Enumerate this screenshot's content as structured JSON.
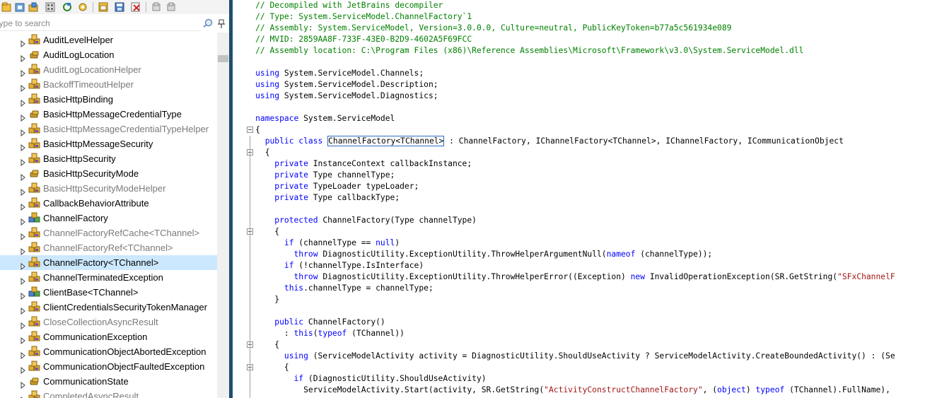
{
  "search": {
    "placeholder": "Type to search"
  },
  "tree": {
    "items": [
      {
        "label": "AuditLevelHelper",
        "dim": false,
        "icon": "class-icon",
        "selected": false
      },
      {
        "label": "AuditLogLocation",
        "dim": false,
        "icon": "enum-icon",
        "selected": false
      },
      {
        "label": "AuditLogLocationHelper",
        "dim": true,
        "icon": "class-icon",
        "selected": false
      },
      {
        "label": "BackoffTimeoutHelper",
        "dim": true,
        "icon": "class-icon",
        "selected": false
      },
      {
        "label": "BasicHttpBinding",
        "dim": false,
        "icon": "class-icon",
        "selected": false
      },
      {
        "label": "BasicHttpMessageCredentialType",
        "dim": false,
        "icon": "enum-icon",
        "selected": false
      },
      {
        "label": "BasicHttpMessageCredentialTypeHelper",
        "dim": true,
        "icon": "class-icon",
        "selected": false
      },
      {
        "label": "BasicHttpMessageSecurity",
        "dim": false,
        "icon": "class-icon",
        "selected": false
      },
      {
        "label": "BasicHttpSecurity",
        "dim": false,
        "icon": "class-icon",
        "selected": false
      },
      {
        "label": "BasicHttpSecurityMode",
        "dim": false,
        "icon": "enum-icon",
        "selected": false
      },
      {
        "label": "BasicHttpSecurityModeHelper",
        "dim": true,
        "icon": "class-icon",
        "selected": false
      },
      {
        "label": "CallbackBehaviorAttribute",
        "dim": false,
        "icon": "class-icon",
        "selected": false
      },
      {
        "label": "ChannelFactory",
        "dim": false,
        "icon": "abstract-class-icon",
        "selected": false
      },
      {
        "label": "ChannelFactoryRefCache<TChannel>",
        "dim": true,
        "icon": "class-icon",
        "selected": false
      },
      {
        "label": "ChannelFactoryRef<TChannel>",
        "dim": true,
        "icon": "class-icon",
        "selected": false
      },
      {
        "label": "ChannelFactory<TChannel>",
        "dim": false,
        "icon": "class-icon",
        "selected": true
      },
      {
        "label": "ChannelTerminatedException",
        "dim": false,
        "icon": "class-icon",
        "selected": false
      },
      {
        "label": "ClientBase<TChannel>",
        "dim": false,
        "icon": "abstract-class-icon",
        "selected": false
      },
      {
        "label": "ClientCredentialsSecurityTokenManager",
        "dim": false,
        "icon": "class-icon",
        "selected": false
      },
      {
        "label": "CloseCollectionAsyncResult",
        "dim": true,
        "icon": "class-icon",
        "selected": false
      },
      {
        "label": "CommunicationException",
        "dim": false,
        "icon": "class-icon",
        "selected": false
      },
      {
        "label": "CommunicationObjectAbortedException",
        "dim": false,
        "icon": "class-icon",
        "selected": false
      },
      {
        "label": "CommunicationObjectFaultedException",
        "dim": false,
        "icon": "class-icon",
        "selected": false
      },
      {
        "label": "CommunicationState",
        "dim": false,
        "icon": "enum-icon",
        "selected": false
      },
      {
        "label": "CompletedAsyncResult",
        "dim": true,
        "icon": "class-icon",
        "selected": false
      }
    ]
  },
  "code": {
    "lines": [
      {
        "indent": 2,
        "tokens": [
          {
            "t": "c",
            "v": "// Decompiled with JetBrains decompiler"
          }
        ]
      },
      {
        "indent": 2,
        "tokens": [
          {
            "t": "c",
            "v": "// Type: System.ServiceModel.ChannelFactory`1"
          }
        ]
      },
      {
        "indent": 2,
        "tokens": [
          {
            "t": "c",
            "v": "// Assembly: System.ServiceModel, Version=3.0.0.0, Culture=neutral, PublicKeyToken=b77a5c561934e089"
          }
        ]
      },
      {
        "indent": 2,
        "tokens": [
          {
            "t": "c",
            "v": "// MVID: 2859AA8F-733F-43E0-B2D9-4602A5F69FCC"
          }
        ]
      },
      {
        "indent": 2,
        "tokens": [
          {
            "t": "c",
            "v": "// Assembly location: C:\\Program Files (x86)\\Reference Assemblies\\Microsoft\\Framework\\v3.0\\System.ServiceModel.dll"
          }
        ]
      },
      {
        "indent": 2,
        "tokens": []
      },
      {
        "indent": 2,
        "tokens": [
          {
            "t": "k",
            "v": "using"
          },
          {
            "t": "p",
            "v": " System.ServiceModel.Channels;"
          }
        ]
      },
      {
        "indent": 2,
        "tokens": [
          {
            "t": "k",
            "v": "using"
          },
          {
            "t": "p",
            "v": " System.ServiceModel.Description;"
          }
        ]
      },
      {
        "indent": 2,
        "tokens": [
          {
            "t": "k",
            "v": "using"
          },
          {
            "t": "p",
            "v": " System.ServiceModel.Diagnostics;"
          }
        ]
      },
      {
        "indent": 2,
        "tokens": []
      },
      {
        "indent": 2,
        "tokens": [
          {
            "t": "k",
            "v": "namespace"
          },
          {
            "t": "p",
            "v": " System.ServiceModel"
          }
        ]
      },
      {
        "indent": 2,
        "tokens": [
          {
            "t": "p",
            "v": "{"
          }
        ],
        "fold": true
      },
      {
        "indent": 4,
        "tokens": [
          {
            "t": "k",
            "v": "public class"
          },
          {
            "t": "p",
            "v": " "
          },
          {
            "t": "h",
            "v": "ChannelFactory<TChannel>"
          },
          {
            "t": "p",
            "v": " : ChannelFactory, IChannelFactory<TChannel>, IChannelFactory, ICommunicationObject"
          }
        ]
      },
      {
        "indent": 4,
        "tokens": [
          {
            "t": "p",
            "v": "{"
          }
        ],
        "fold": true
      },
      {
        "indent": 6,
        "tokens": [
          {
            "t": "k",
            "v": "private"
          },
          {
            "t": "p",
            "v": " InstanceContext callbackInstance;"
          }
        ]
      },
      {
        "indent": 6,
        "tokens": [
          {
            "t": "k",
            "v": "private"
          },
          {
            "t": "p",
            "v": " Type channelType;"
          }
        ]
      },
      {
        "indent": 6,
        "tokens": [
          {
            "t": "k",
            "v": "private"
          },
          {
            "t": "p",
            "v": " TypeLoader typeLoader;"
          }
        ]
      },
      {
        "indent": 6,
        "tokens": [
          {
            "t": "k",
            "v": "private"
          },
          {
            "t": "p",
            "v": " Type callbackType;"
          }
        ]
      },
      {
        "indent": 6,
        "tokens": []
      },
      {
        "indent": 6,
        "tokens": [
          {
            "t": "k",
            "v": "protected"
          },
          {
            "t": "p",
            "v": " ChannelFactory(Type channelType)"
          }
        ]
      },
      {
        "indent": 6,
        "tokens": [
          {
            "t": "p",
            "v": "{"
          }
        ],
        "fold": true
      },
      {
        "indent": 8,
        "tokens": [
          {
            "t": "k",
            "v": "if"
          },
          {
            "t": "p",
            "v": " (channelType == "
          },
          {
            "t": "k",
            "v": "null"
          },
          {
            "t": "p",
            "v": ")"
          }
        ]
      },
      {
        "indent": 10,
        "tokens": [
          {
            "t": "k",
            "v": "throw"
          },
          {
            "t": "p",
            "v": " DiagnosticUtility.ExceptionUtility.ThrowHelperArgumentNull("
          },
          {
            "t": "k",
            "v": "nameof"
          },
          {
            "t": "p",
            "v": " (channelType));"
          }
        ]
      },
      {
        "indent": 8,
        "tokens": [
          {
            "t": "k",
            "v": "if"
          },
          {
            "t": "p",
            "v": " (!channelType.IsInterface)"
          }
        ]
      },
      {
        "indent": 10,
        "tokens": [
          {
            "t": "k",
            "v": "throw"
          },
          {
            "t": "p",
            "v": " DiagnosticUtility.ExceptionUtility.ThrowHelperError((Exception) "
          },
          {
            "t": "k",
            "v": "new"
          },
          {
            "t": "p",
            "v": " InvalidOperationException(SR.GetString("
          },
          {
            "t": "s",
            "v": "\"SFxChannelF"
          }
        ]
      },
      {
        "indent": 8,
        "tokens": [
          {
            "t": "k",
            "v": "this"
          },
          {
            "t": "p",
            "v": ".channelType = channelType;"
          }
        ]
      },
      {
        "indent": 6,
        "tokens": [
          {
            "t": "p",
            "v": "}"
          }
        ]
      },
      {
        "indent": 6,
        "tokens": []
      },
      {
        "indent": 6,
        "tokens": [
          {
            "t": "k",
            "v": "public"
          },
          {
            "t": "p",
            "v": " ChannelFactory()"
          }
        ]
      },
      {
        "indent": 8,
        "tokens": [
          {
            "t": "p",
            "v": ": "
          },
          {
            "t": "k",
            "v": "this"
          },
          {
            "t": "p",
            "v": "("
          },
          {
            "t": "k",
            "v": "typeof"
          },
          {
            "t": "p",
            "v": " (TChannel))"
          }
        ]
      },
      {
        "indent": 6,
        "tokens": [
          {
            "t": "p",
            "v": "{"
          }
        ],
        "fold": true
      },
      {
        "indent": 8,
        "tokens": [
          {
            "t": "k",
            "v": "using"
          },
          {
            "t": "p",
            "v": " (ServiceModelActivity activity = DiagnosticUtility.ShouldUseActivity ? ServiceModelActivity.CreateBoundedActivity() : (Se"
          }
        ]
      },
      {
        "indent": 8,
        "tokens": [
          {
            "t": "p",
            "v": "{"
          }
        ],
        "fold": true
      },
      {
        "indent": 10,
        "tokens": [
          {
            "t": "k",
            "v": "if"
          },
          {
            "t": "p",
            "v": " (DiagnosticUtility.ShouldUseActivity)"
          }
        ]
      },
      {
        "indent": 12,
        "tokens": [
          {
            "t": "p",
            "v": "ServiceModelActivity.Start(activity, SR.GetString("
          },
          {
            "t": "s",
            "v": "\"ActivityConstructChannelFactory\""
          },
          {
            "t": "p",
            "v": ", ("
          },
          {
            "t": "k",
            "v": "object"
          },
          {
            "t": "p",
            "v": ") "
          },
          {
            "t": "k",
            "v": "typeof"
          },
          {
            "t": "p",
            "v": " (TChannel).FullName),"
          }
        ]
      }
    ]
  },
  "colors": {
    "comment": "#008000",
    "keyword": "#0000ff",
    "string": "#a31515",
    "selection": "#cce8ff",
    "divider": "#1b4f72"
  }
}
